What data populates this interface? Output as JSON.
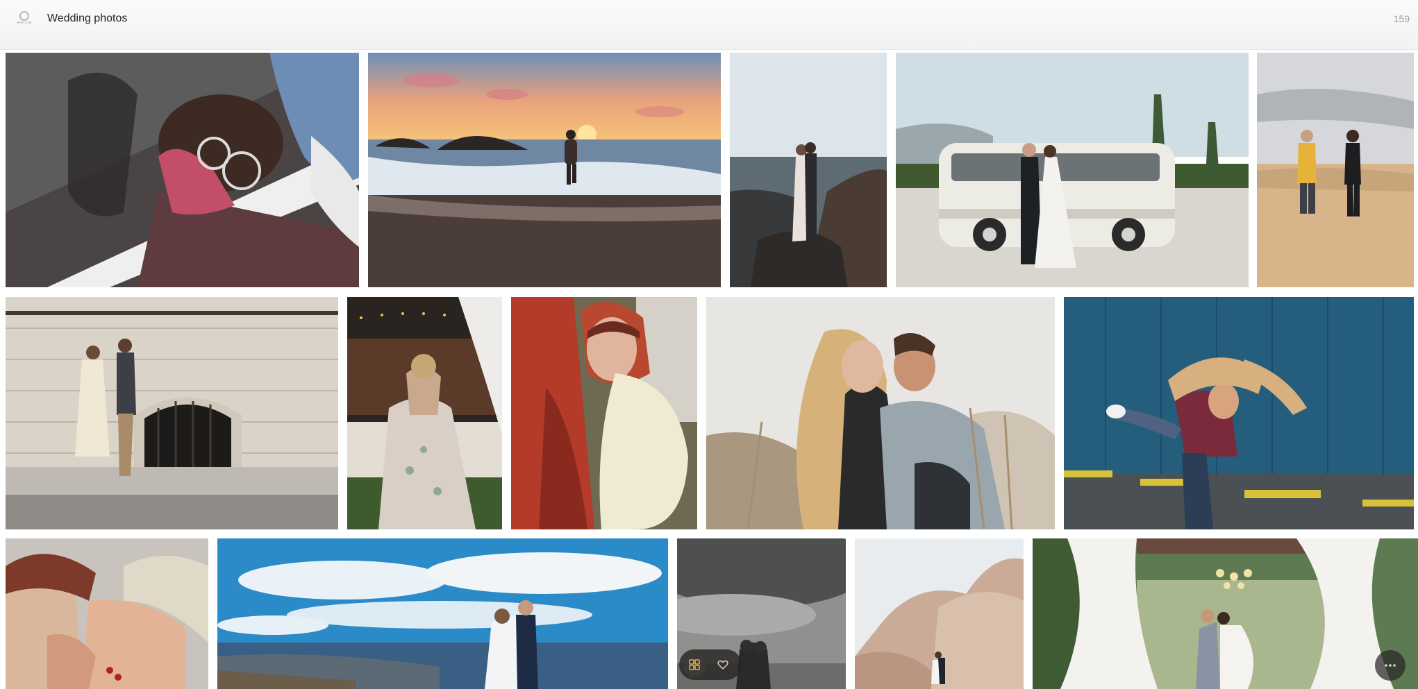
{
  "header": {
    "logo_icon": "camera-logo-icon",
    "logo_text": "KAPTUR",
    "title": "Wedding photos",
    "count": "159"
  },
  "gallery": {
    "photos": [
      {
        "name": "photo-woman-glasses-pink-cap"
      },
      {
        "name": "photo-man-walking-sunset-beach"
      },
      {
        "name": "photo-couple-kissing-on-rocks"
      },
      {
        "name": "photo-couple-kissing-by-van"
      },
      {
        "name": "photo-couple-holding-hands-sand"
      },
      {
        "name": "photo-couple-walking-by-stone-wall"
      },
      {
        "name": "photo-bride-dancing-floral-dress"
      },
      {
        "name": "photo-woman-red-hood-jacket"
      },
      {
        "name": "photo-couple-in-field"
      },
      {
        "name": "photo-piggyback-ride-blue-wall"
      },
      {
        "name": "photo-couple-beanies-close"
      },
      {
        "name": "photo-couple-kissing-seaside-blue-sky"
      },
      {
        "name": "photo-couple-stormy-sky"
      },
      {
        "name": "photo-couple-desert-boulders"
      },
      {
        "name": "photo-couple-kiss-chandelier-curtains"
      }
    ]
  },
  "toolbar": {
    "grid_icon": "grid-icon",
    "heart_icon": "heart-icon",
    "more_icon": "more-dots-icon"
  },
  "colors": {
    "header_bg": "#f6f6f4",
    "toolbar_bg": "#2b2926",
    "icon_accent": "#d9b04a"
  }
}
